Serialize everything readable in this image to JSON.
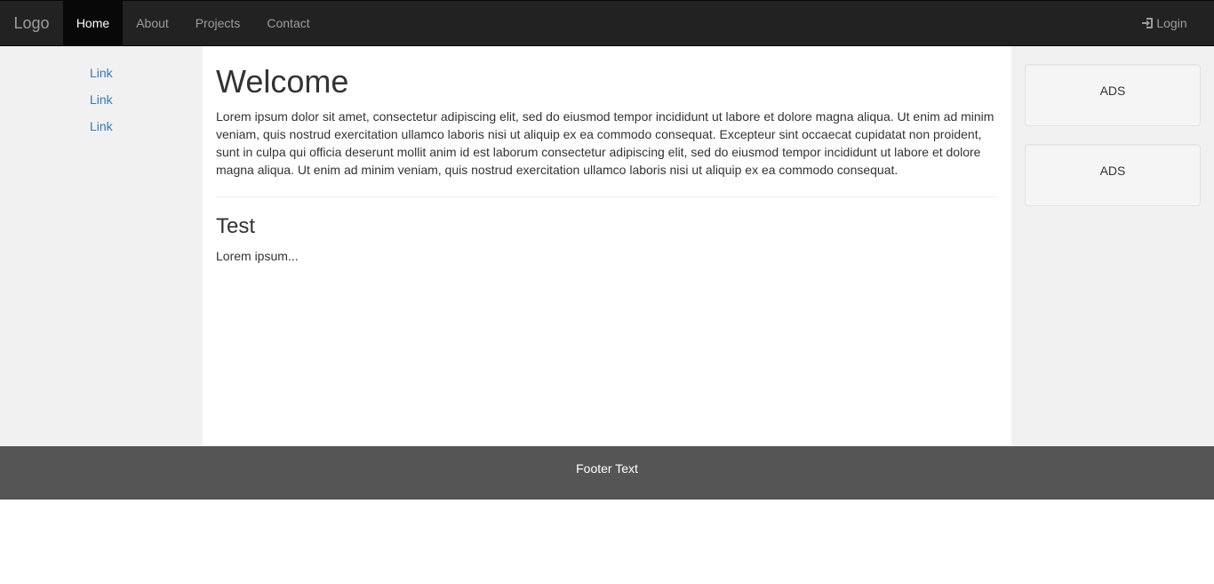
{
  "navbar": {
    "brand": "Logo",
    "items": [
      {
        "label": "Home",
        "active": true
      },
      {
        "label": "About",
        "active": false
      },
      {
        "label": "Projects",
        "active": false
      },
      {
        "label": "Contact",
        "active": false
      }
    ],
    "login_label": "Login",
    "login_icon": "log-in-icon"
  },
  "sidenav_left": {
    "links": [
      "Link",
      "Link",
      "Link"
    ]
  },
  "main": {
    "title": "Welcome",
    "paragraph": "Lorem ipsum dolor sit amet, consectetur adipiscing elit, sed do eiusmod tempor incididunt ut labore et dolore magna aliqua. Ut enim ad minim veniam, quis nostrud exercitation ullamco laboris nisi ut aliquip ex ea commodo consequat. Excepteur sint occaecat cupidatat non proident, sunt in culpa qui officia deserunt mollit anim id est laborum consectetur adipiscing elit, sed do eiusmod tempor incididunt ut labore et dolore magna aliqua. Ut enim ad minim veniam, quis nostrud exercitation ullamco laboris nisi ut aliquip ex ea commodo consequat.",
    "subtitle": "Test",
    "sub_paragraph": "Lorem ipsum..."
  },
  "sidenav_right": {
    "ads": [
      "ADS",
      "ADS"
    ]
  },
  "footer": {
    "text": "Footer Text"
  },
  "colors": {
    "navbar_bg": "#222222",
    "active_bg": "#080808",
    "link": "#337ab7",
    "sidenav_bg": "#f1f1f1",
    "footer_bg": "#555555"
  }
}
